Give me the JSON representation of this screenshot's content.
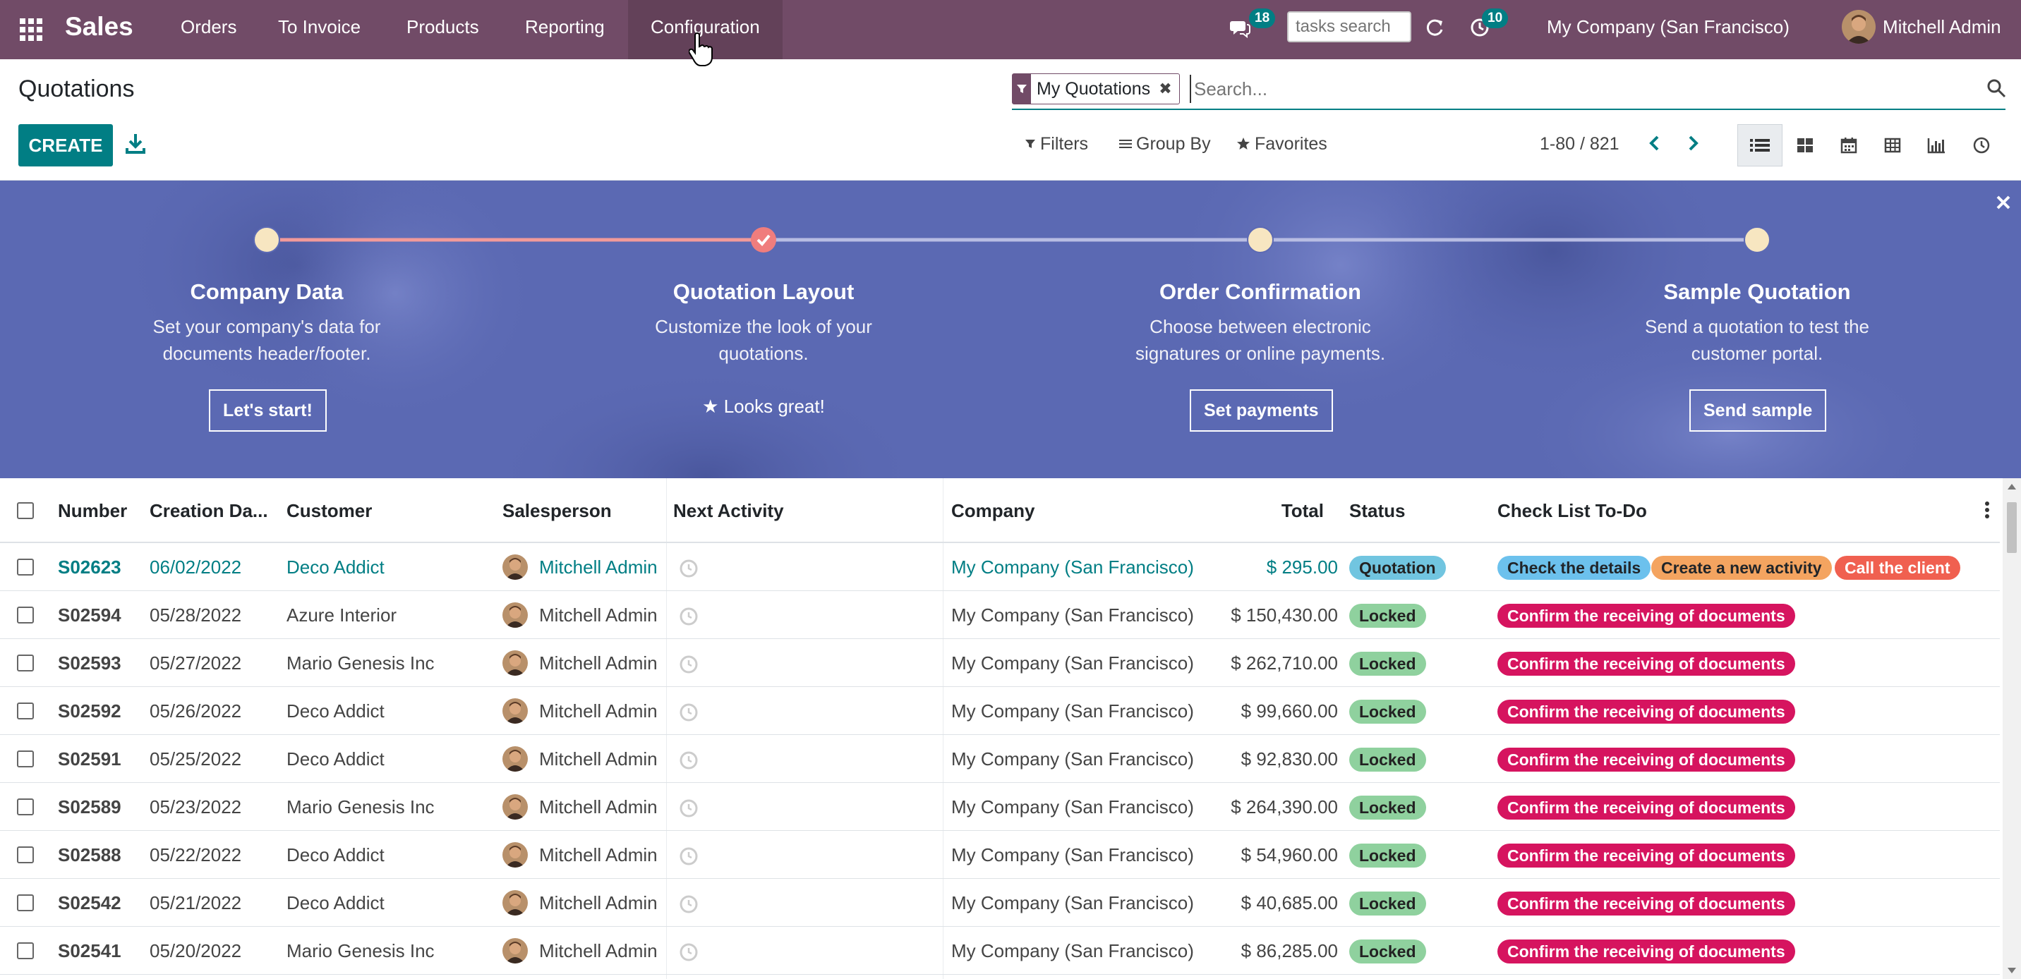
{
  "navbar": {
    "brand": "Sales",
    "menus": [
      "Orders",
      "To Invoice",
      "Products",
      "Reporting",
      "Configuration"
    ],
    "active_menu": "Configuration",
    "messages_count": "18",
    "activities_count": "10",
    "tasks_search_placeholder": "tasks search",
    "company": "My Company (San Francisco)",
    "user": "Mitchell Admin"
  },
  "control_panel": {
    "title": "Quotations",
    "create_label": "CREATE",
    "facet_label": "My Quotations",
    "search_placeholder": "Search...",
    "filters_label": "Filters",
    "group_by_label": "Group By",
    "favorites_label": "Favorites",
    "pager_value": "1-80 / 821",
    "views": [
      "list-view",
      "kanban-view",
      "calendar-view",
      "pivot-view",
      "graph-view",
      "activity-view"
    ],
    "active_view": "list-view"
  },
  "onboarding": {
    "steps": [
      {
        "title": "Company Data",
        "desc_line1": "Set your company's data for",
        "desc_line2": "documents header/footer.",
        "button": "Let's start!",
        "done": false
      },
      {
        "title": "Quotation Layout",
        "desc_line1": "Customize the look of your",
        "desc_line2": "quotations.",
        "done_label": "Looks great!",
        "done": true
      },
      {
        "title": "Order Confirmation",
        "desc_line1": "Choose between electronic",
        "desc_line2": "signatures or online payments.",
        "button": "Set payments",
        "done": false
      },
      {
        "title": "Sample Quotation",
        "desc_line1": "Send a quotation to test the",
        "desc_line2": "customer portal.",
        "button": "Send sample",
        "done": false
      }
    ]
  },
  "list": {
    "columns": {
      "number": "Number",
      "creation_date": "Creation Da...",
      "customer": "Customer",
      "salesperson": "Salesperson",
      "next_activity": "Next Activity",
      "company": "Company",
      "total": "Total",
      "status": "Status",
      "checklist": "Check List To-Do"
    },
    "rows": [
      {
        "number": "S02623",
        "date": "06/02/2022",
        "customer": "Deco Addict",
        "salesperson": "Mitchell Admin",
        "company": "My Company (San Francisco)",
        "total": "$ 295.00",
        "status": "Quotation",
        "tags": [
          "Check the details",
          "Create a new activity",
          "Call the client"
        ]
      },
      {
        "number": "S02594",
        "date": "05/28/2022",
        "customer": "Azure Interior",
        "salesperson": "Mitchell Admin",
        "company": "My Company (San Francisco)",
        "total": "$ 150,430.00",
        "status": "Locked",
        "tags": [
          "Confirm the receiving of documents"
        ]
      },
      {
        "number": "S02593",
        "date": "05/27/2022",
        "customer": "Mario Genesis Inc",
        "salesperson": "Mitchell Admin",
        "company": "My Company (San Francisco)",
        "total": "$ 262,710.00",
        "status": "Locked",
        "tags": [
          "Confirm the receiving of documents"
        ]
      },
      {
        "number": "S02592",
        "date": "05/26/2022",
        "customer": "Deco Addict",
        "salesperson": "Mitchell Admin",
        "company": "My Company (San Francisco)",
        "total": "$ 99,660.00",
        "status": "Locked",
        "tags": [
          "Confirm the receiving of documents"
        ]
      },
      {
        "number": "S02591",
        "date": "05/25/2022",
        "customer": "Deco Addict",
        "salesperson": "Mitchell Admin",
        "company": "My Company (San Francisco)",
        "total": "$ 92,830.00",
        "status": "Locked",
        "tags": [
          "Confirm the receiving of documents"
        ]
      },
      {
        "number": "S02589",
        "date": "05/23/2022",
        "customer": "Mario Genesis Inc",
        "salesperson": "Mitchell Admin",
        "company": "My Company (San Francisco)",
        "total": "$ 264,390.00",
        "status": "Locked",
        "tags": [
          "Confirm the receiving of documents"
        ]
      },
      {
        "number": "S02588",
        "date": "05/22/2022",
        "customer": "Deco Addict",
        "salesperson": "Mitchell Admin",
        "company": "My Company (San Francisco)",
        "total": "$ 54,960.00",
        "status": "Locked",
        "tags": [
          "Confirm the receiving of documents"
        ]
      },
      {
        "number": "S02542",
        "date": "05/21/2022",
        "customer": "Deco Addict",
        "salesperson": "Mitchell Admin",
        "company": "My Company (San Francisco)",
        "total": "$ 40,685.00",
        "status": "Locked",
        "tags": [
          "Confirm the receiving of documents"
        ]
      },
      {
        "number": "S02541",
        "date": "05/20/2022",
        "customer": "Mario Genesis Inc",
        "salesperson": "Mitchell Admin",
        "company": "My Company (San Francisco)",
        "total": "$ 86,285.00",
        "status": "Locked",
        "tags": [
          "Confirm the receiving of documents"
        ]
      }
    ]
  },
  "colors": {
    "brand": "#714b67",
    "accent": "#017e84",
    "banner": "#5c6ab4",
    "status_quotation": "#71c5e0",
    "status_locked": "#8fd19e",
    "tag_blue": "#6cc1ed",
    "tag_orange": "#f4a460",
    "tag_red": "#f06050",
    "tag_crimson": "#d6145f"
  }
}
